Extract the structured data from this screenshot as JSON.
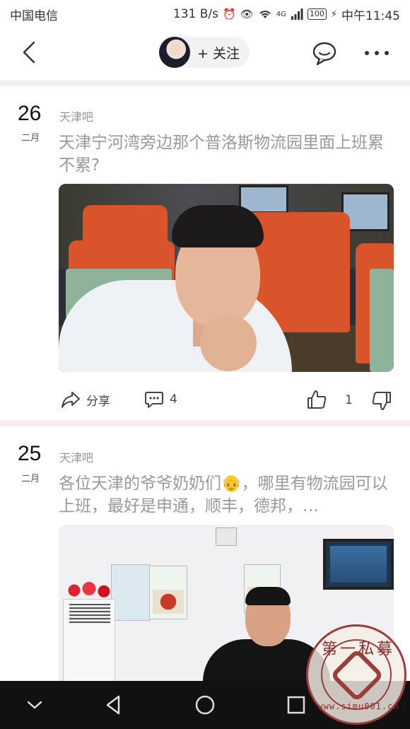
{
  "status_bar": {
    "carrier": "中国电信",
    "network_speed": "131 B/s",
    "signal_tag": "4G",
    "battery": "100",
    "time": "中午11:45"
  },
  "nav": {
    "follow_label": "+ 关注"
  },
  "posts": [
    {
      "day": "26",
      "month": "二月",
      "forum": "天津吧",
      "title": "天津宁河湾旁边那个普洛斯物流园里面上班累不累?",
      "share_label": "分享",
      "comment_count": "4",
      "like_count": "1"
    },
    {
      "day": "25",
      "month": "二月",
      "forum": "天津吧",
      "title": "各位天津的爷爷奶奶们👴，哪里有物流园可以上班，最好是申通，顺丰，德邦，…"
    }
  ],
  "watermark": {
    "top_text": "第一私募",
    "url_text": "www.simu001.cn"
  },
  "colors": {
    "divider": "#f6eef1",
    "muted_text": "#999999",
    "watermark_red": "#9a3d3b",
    "system_nav_bg": "#111111"
  },
  "icons": [
    "back-arrow-icon",
    "chat-bubble-icon",
    "more-dots-icon",
    "share-arrow-icon",
    "comment-icon",
    "thumb-up-icon",
    "thumb-down-icon",
    "nav-back-triangle-icon",
    "nav-home-circle-icon",
    "nav-recents-square-icon",
    "nav-collapse-chevron-icon"
  ]
}
